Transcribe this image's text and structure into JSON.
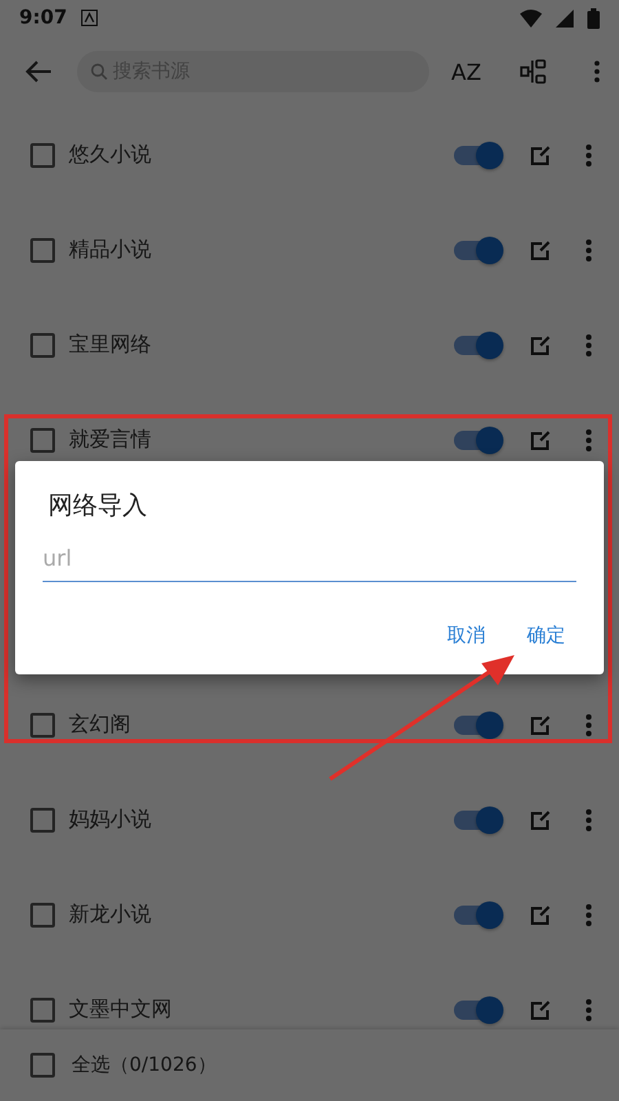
{
  "status_bar": {
    "time": "9:07"
  },
  "toolbar": {
    "search": {
      "placeholder": "搜索书源"
    },
    "sort_label": "AZ"
  },
  "sources_above": [
    {
      "name": "悠久小说",
      "checked": false,
      "enabled": true
    },
    {
      "name": "精品小说",
      "checked": false,
      "enabled": true
    },
    {
      "name": "宝里网络",
      "checked": false,
      "enabled": true
    },
    {
      "name": "就爱言情",
      "checked": false,
      "enabled": true
    }
  ],
  "sources_below": [
    {
      "name": "玄幻阁",
      "checked": false,
      "enabled": true
    },
    {
      "name": "妈妈小说",
      "checked": false,
      "enabled": true
    },
    {
      "name": "新龙小说",
      "checked": false,
      "enabled": true
    },
    {
      "name": "文墨中文网",
      "checked": false,
      "enabled": true
    }
  ],
  "bottom_bar": {
    "select_all": {
      "label": "全选（0/1026）",
      "checked": false
    }
  },
  "dialog": {
    "title": "网络导入",
    "field": {
      "placeholder": "url"
    },
    "buttons": [
      "取消",
      "确定"
    ]
  }
}
